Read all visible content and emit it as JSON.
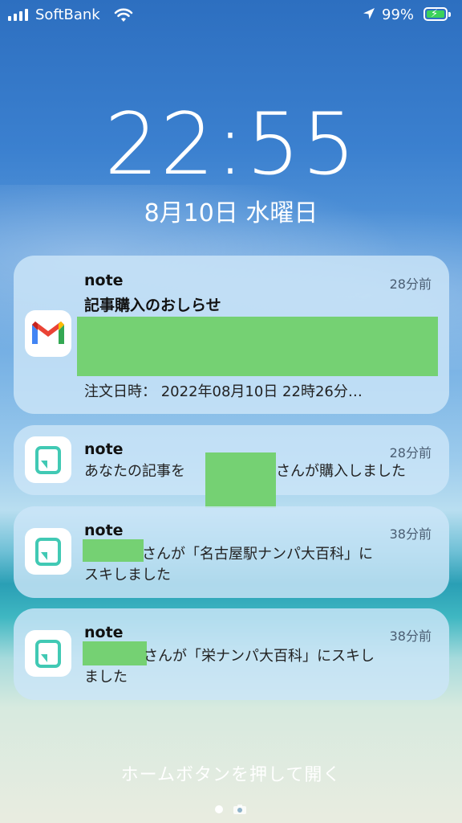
{
  "status_bar": {
    "carrier": "SoftBank",
    "battery_percent": "99%",
    "icons": [
      "signal-icon",
      "wifi-icon",
      "location-arrow-icon",
      "battery-charging-icon"
    ]
  },
  "lock_screen": {
    "time": "22:55",
    "date": "8月10日 水曜日",
    "home_hint": "ホームボタンを押して開く"
  },
  "notifications": [
    {
      "app": "note",
      "icon": "gmail-icon",
      "time_ago": "28分前",
      "subject": "記事購入のおしらせ",
      "body": "注文日時： 2022年08月10日 22時26分…"
    },
    {
      "app": "note",
      "icon": "note-app-icon",
      "time_ago": "28分前",
      "body_before": "あなたの記事を",
      "body_after": "さんが購入しました"
    },
    {
      "app": "note",
      "icon": "note-app-icon",
      "time_ago": "38分前",
      "body": "さんが「名古屋駅ナンパ大百科」に",
      "body_line2": "スキしました"
    },
    {
      "app": "note",
      "icon": "note-app-icon",
      "time_ago": "38分前",
      "body": "さんが「栄ナンパ大百科」にスキし",
      "body_line2": "ました"
    }
  ],
  "colors": {
    "redaction": "#75d173",
    "notification_bg": "#cce5f8",
    "note_icon": "#41c9b4"
  }
}
